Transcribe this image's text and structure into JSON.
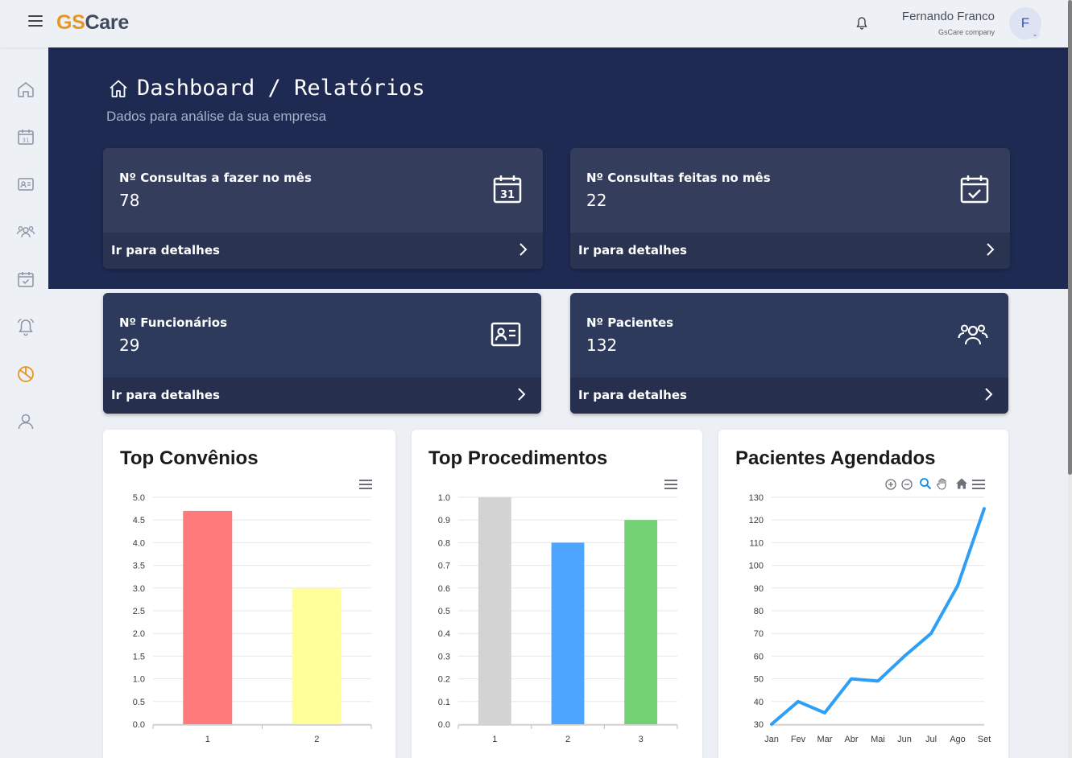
{
  "topbar": {
    "logo_gs": "GS",
    "logo_care": "Care",
    "user_name": "Fernando Franco",
    "user_company": "GsCare company",
    "avatar_letter": "F"
  },
  "sidebar": {
    "items": [
      {
        "icon": "home-icon"
      },
      {
        "icon": "calendar-icon"
      },
      {
        "icon": "id-card-icon"
      },
      {
        "icon": "users-icon"
      },
      {
        "icon": "calendar-check-icon"
      },
      {
        "icon": "alarm-icon"
      },
      {
        "icon": "pie-chart-icon",
        "active": true,
        "color": "#e8961e"
      },
      {
        "icon": "user-icon"
      }
    ]
  },
  "header": {
    "title": "Dashboard / Relatórios",
    "subtitle": "Dados para análise da sua empresa"
  },
  "stats": [
    {
      "label": "Nº Consultas a fazer no mês",
      "value": "78",
      "link": "Ir para detalhes",
      "icon": "calendar-31-icon"
    },
    {
      "label": "Nº Consultas feitas no mês",
      "value": "22",
      "link": "Ir para detalhes",
      "icon": "calendar-check-icon"
    },
    {
      "label": "Nº Funcionários",
      "value": "29",
      "link": "Ir para detalhes",
      "icon": "id-card-icon"
    },
    {
      "label": "Nº Pacientes",
      "value": "132",
      "link": "Ir para detalhes",
      "icon": "users-icon"
    }
  ],
  "charts_titles": {
    "convenios": "Top Convênios",
    "procedimentos": "Top Procedimentos",
    "pacientes": "Pacientes Agendados"
  },
  "chart_data": [
    {
      "type": "bar",
      "title": "Top Convênios",
      "categories": [
        "1",
        "2"
      ],
      "values": [
        4.7,
        3.0
      ],
      "colors": [
        "#ff7b7b",
        "#ffff99"
      ],
      "ylim": [
        0,
        5
      ],
      "yticks": [
        "0.0",
        "0.5",
        "1.0",
        "1.5",
        "2.0",
        "2.5",
        "3.0",
        "3.5",
        "4.0",
        "4.5",
        "5.0"
      ]
    },
    {
      "type": "bar",
      "title": "Top Procedimentos",
      "categories": [
        "1",
        "2",
        "3"
      ],
      "values": [
        1.0,
        0.8,
        0.9
      ],
      "colors": [
        "#d3d3d3",
        "#4ea5ff",
        "#73d073"
      ],
      "ylim": [
        0,
        1
      ],
      "yticks": [
        "0.0",
        "0.1",
        "0.2",
        "0.3",
        "0.4",
        "0.5",
        "0.6",
        "0.7",
        "0.8",
        "0.9",
        "1.0"
      ]
    },
    {
      "type": "line",
      "title": "Pacientes Agendados",
      "categories": [
        "Jan",
        "Fev",
        "Mar",
        "Abr",
        "Mai",
        "Jun",
        "Jul",
        "Ago",
        "Set"
      ],
      "values": [
        30,
        40,
        35,
        50,
        49,
        60,
        70,
        91,
        125
      ],
      "color": "#2e9ff5",
      "ylim": [
        30,
        130
      ],
      "yticks": [
        "30",
        "40",
        "50",
        "60",
        "70",
        "80",
        "90",
        "100",
        "110",
        "120",
        "130"
      ]
    }
  ]
}
